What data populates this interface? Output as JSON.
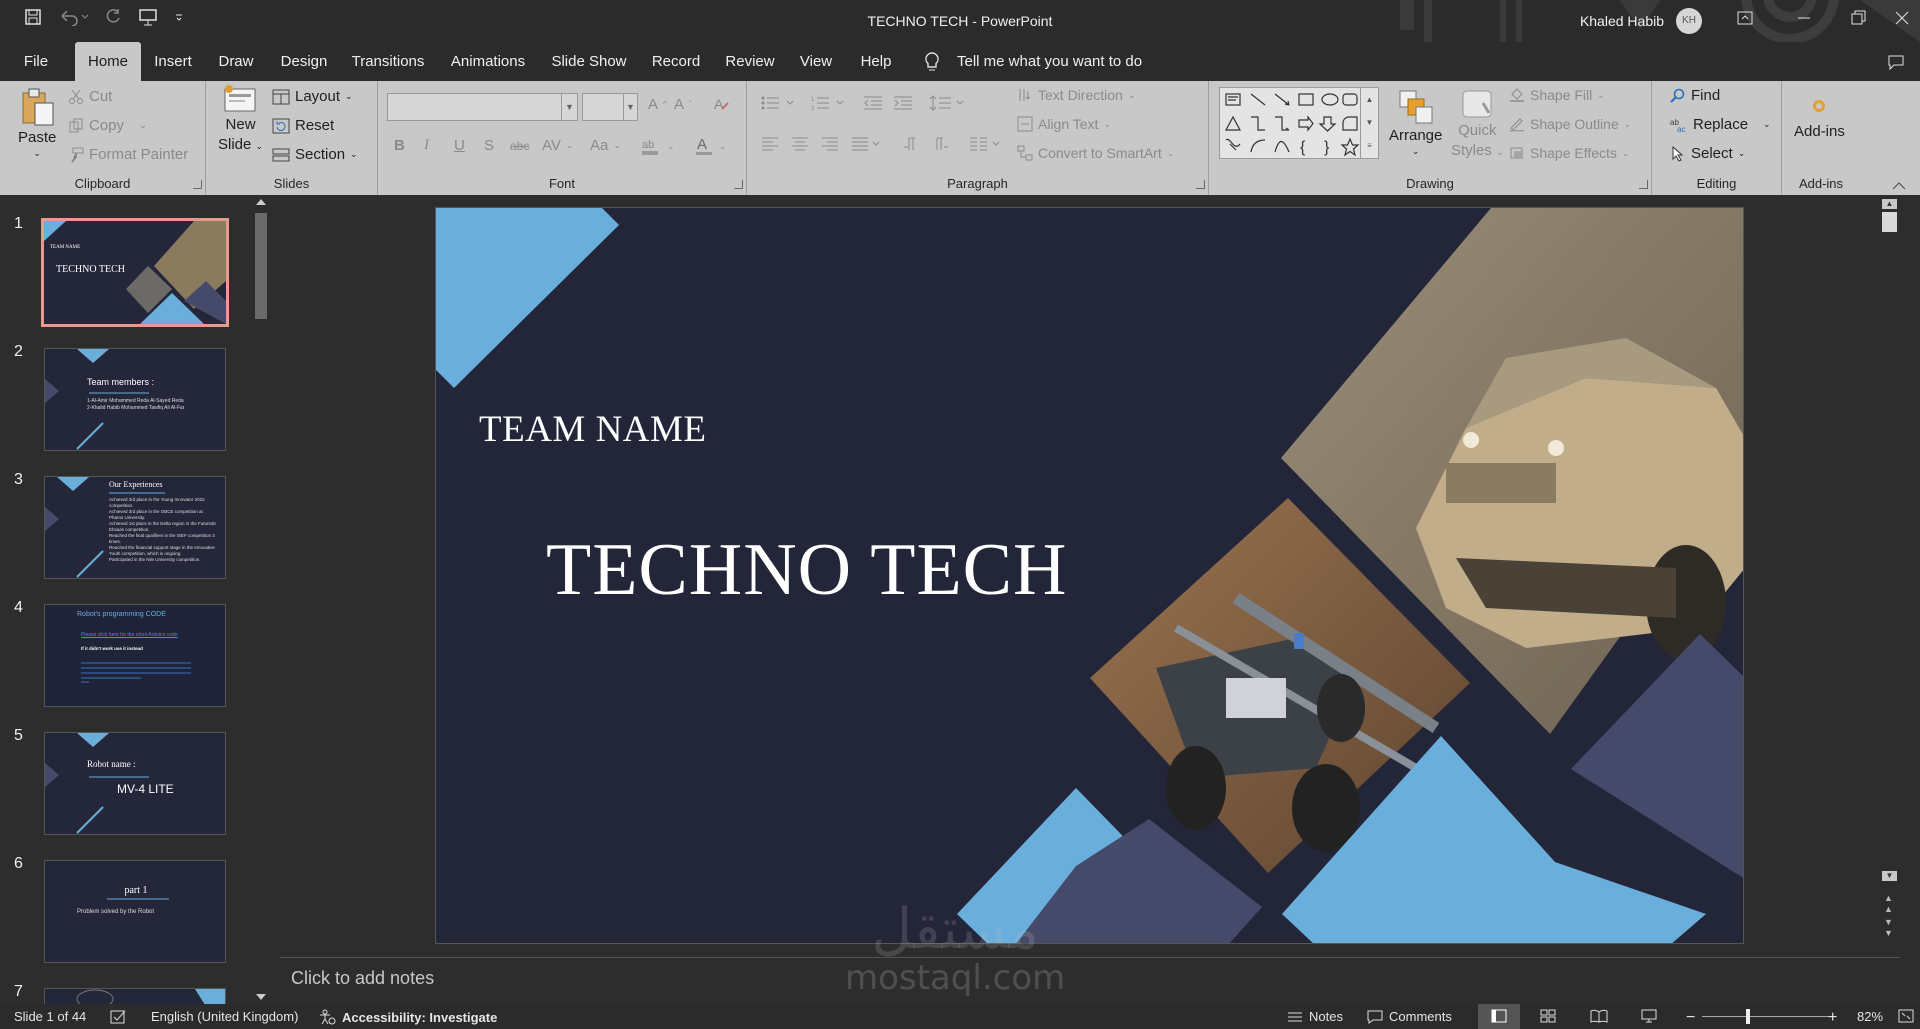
{
  "window": {
    "title": "TECHNO TECH  -  PowerPoint",
    "user_name": "Khaled Habib",
    "user_initials": "KH"
  },
  "menu": {
    "file": "File",
    "tabs": [
      "Home",
      "Insert",
      "Draw",
      "Design",
      "Transitions",
      "Animations",
      "Slide Show",
      "Record",
      "Review",
      "View",
      "Help"
    ],
    "tell_me": "Tell me what you want to do"
  },
  "ribbon": {
    "clipboard": {
      "label": "Clipboard",
      "paste": "Paste",
      "cut": "Cut",
      "copy": "Copy",
      "format_painter": "Format Painter"
    },
    "slides": {
      "label": "Slides",
      "new_slide_1": "New",
      "new_slide_2": "Slide",
      "layout": "Layout",
      "reset": "Reset",
      "section": "Section"
    },
    "font": {
      "label": "Font"
    },
    "paragraph": {
      "label": "Paragraph",
      "text_direction": "Text Direction",
      "align_text": "Align Text",
      "convert_smartart": "Convert to SmartArt"
    },
    "drawing": {
      "label": "Drawing",
      "arrange": "Arrange",
      "quick_styles_1": "Quick",
      "quick_styles_2": "Styles",
      "shape_fill": "Shape Fill",
      "shape_outline": "Shape Outline",
      "shape_effects": "Shape Effects"
    },
    "editing": {
      "label": "Editing",
      "find": "Find",
      "replace": "Replace",
      "select": "Select"
    },
    "addins": {
      "label": "Add-ins",
      "button": "Add-ins"
    }
  },
  "thumbnails": [
    {
      "num": "1",
      "t1": "TEAM NAME",
      "t2": "TECHNO TECH"
    },
    {
      "num": "2",
      "t1": "Team members :",
      "t2": "1-Al-Amir Mohammed Reda Al-Sayed Reda",
      "t3": "2-Khalid Habib Mohammed Tawfiq Ali Al-Far"
    },
    {
      "num": "3",
      "t1": "Our Experiences",
      "items": [
        "Achieved 3rd place in the Young Innovator 2022 competition.",
        "Achieved 3rd place in the OBCE competition at Pharos University.",
        "Achieved 1st place in the Delta region in the Futuristic Ehsaas competition.",
        "Reached the final qualifiers in the ISEF competition 3 times.",
        "Reached the financial support stage in the Innovative Youth competition, which is ongoing.",
        "Participated in the Nile University competition."
      ]
    },
    {
      "num": "4",
      "t1": "Robot's programming CODE",
      "t2": "Please click here for the robot Arduino code",
      "t3": "If it didn't work use it instead"
    },
    {
      "num": "5",
      "t1": "Robot name :",
      "t2": "MV-4 LITE"
    },
    {
      "num": "6",
      "t1": "part 1",
      "t2": "Problem solved by the Robot"
    },
    {
      "num": "7"
    }
  ],
  "slide": {
    "team_name": "TEAM NAME",
    "title": "TECHNO TECH"
  },
  "notes": {
    "placeholder": "Click to add notes"
  },
  "status": {
    "slide_info": "Slide 1 of 44",
    "language": "English (United Kingdom)",
    "accessibility": "Accessibility: Investigate",
    "notes": "Notes",
    "comments": "Comments",
    "zoom": "82%",
    "zoom_level": 0.82
  },
  "watermark": {
    "arabic": "مستقل",
    "latin": "mostaql.com"
  },
  "colors": {
    "accent_light_blue": "#6aaedb",
    "slide_bg": "#232539",
    "slate": "#454a6b",
    "selection": "#e89a8e"
  }
}
